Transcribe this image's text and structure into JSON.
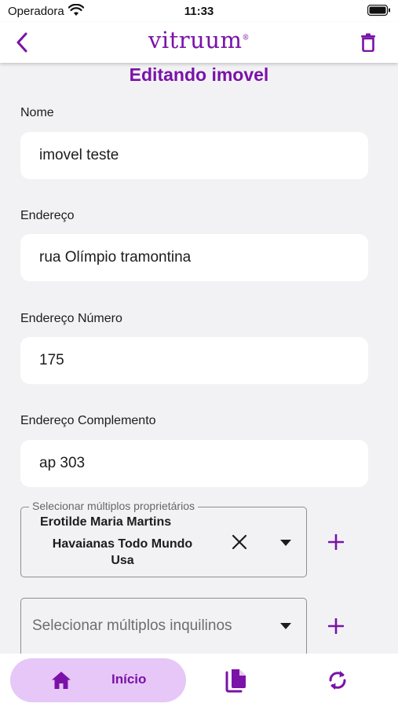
{
  "status_bar": {
    "carrier": "Operadora",
    "time": "11:33",
    "wifi_icon": "wifi-icon",
    "battery_icon": "battery-icon"
  },
  "app_bar": {
    "logo_text": "vitruum",
    "logo_mark": "®",
    "back_icon": "chevron-left-icon",
    "trash_icon": "trash-icon"
  },
  "page_title": "Editando imovel",
  "form": {
    "nome": {
      "label": "Nome",
      "value": "imovel teste"
    },
    "endereco": {
      "label": "Endereço",
      "value": "rua Olímpio tramontina"
    },
    "endereco_numero": {
      "label": "Endereço Número",
      "value": "175"
    },
    "endereco_complemento": {
      "label": "Endereço Complemento",
      "value": "ap 303"
    },
    "proprietarios": {
      "label": "Selecionar múltiplos proprietários",
      "selected": [
        "Erotilde Maria Martins",
        "Havaianas Todo Mundo",
        "Usa"
      ]
    },
    "inquilinos": {
      "placeholder": "Selecionar múltiplos inquilinos"
    }
  },
  "bottom_nav": {
    "home_label": "Início",
    "home_icon": "home-icon",
    "docs_icon": "documents-icon",
    "sync_icon": "sync-icon"
  },
  "colors": {
    "brand": "#7a12a8",
    "nav_active_bg": "#e6c7f7",
    "background": "#f2f2f4"
  }
}
